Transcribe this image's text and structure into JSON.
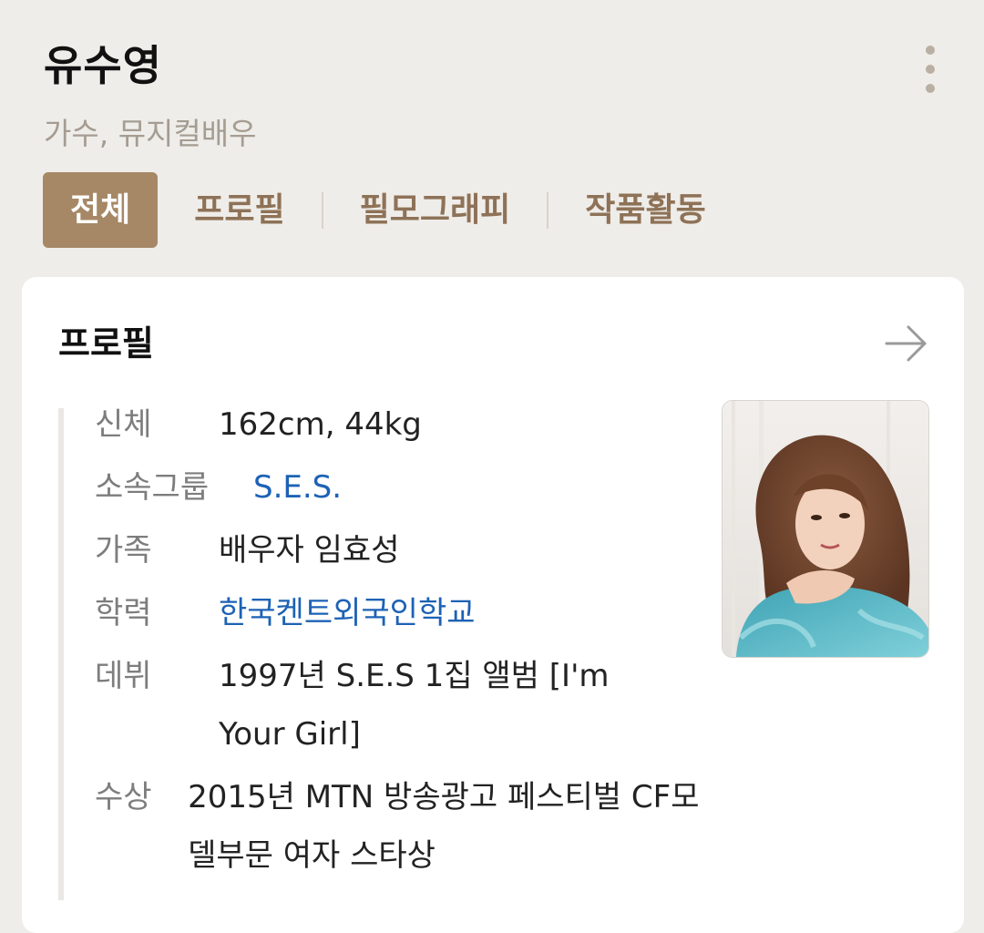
{
  "profile": {
    "name": "유수영",
    "subtitle": "가수, 뮤지컬배우"
  },
  "menu_icon": "more-vertical-icon",
  "tabs": [
    {
      "label": "전체",
      "active": true
    },
    {
      "label": "프로필",
      "active": false
    },
    {
      "label": "필모그래피",
      "active": false
    },
    {
      "label": "작품활동",
      "active": false
    }
  ],
  "card": {
    "title": "프로필",
    "arrow_icon": "arrow-right-icon",
    "photo_icon": "profile-photo",
    "rows": [
      {
        "label": "신체",
        "value": "162cm, 44kg",
        "link": false
      },
      {
        "label": "소속그룹",
        "value": "S.E.S.",
        "link": true
      },
      {
        "label": "가족",
        "value": "배우자 임효성",
        "link": false
      },
      {
        "label": "학력",
        "value": "한국켄트외국인학교",
        "link": true
      },
      {
        "label": "데뷔",
        "value": "1997년 S.E.S 1집 앨범 [I'm Your Girl]",
        "link": false
      },
      {
        "label": "수상",
        "value": "2015년 MTN 방송광고 페스티벌 CF모델부문 여자 스타상",
        "link": false
      }
    ]
  },
  "colors": {
    "background": "#efede9",
    "accent": "#a68866",
    "tab_text": "#8e7257",
    "link": "#1d62b5",
    "label_gray": "#7d7d7d"
  }
}
